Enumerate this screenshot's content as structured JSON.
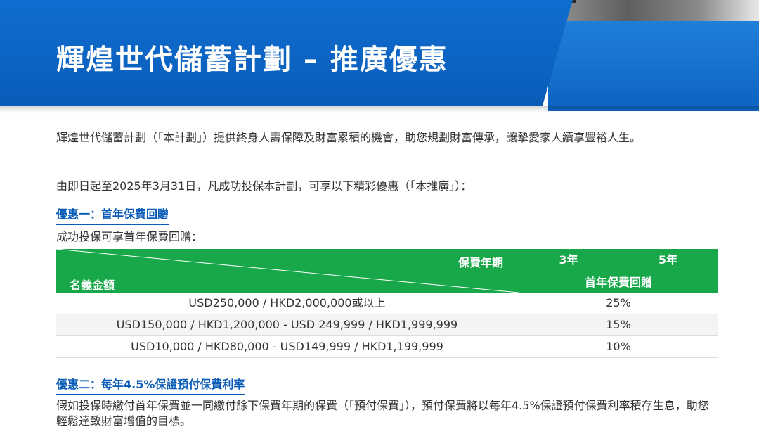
{
  "hero": {
    "title": "輝煌世代儲蓄計劃 – 推廣優惠",
    "colors": {
      "brand_blue": "#0a5cb8",
      "band_blue": "#1f7fd8"
    }
  },
  "intro": "輝煌世代儲蓄計劃（「本計劃」）提供終身人壽保障及財富累積的機會，助您規劃財富傳承，讓摯愛家人續享豐裕人生。",
  "period": "由即日起至2025年3月31日，凡成功投保本計劃，可享以下精彩優惠（「本推廣」）：",
  "offer1": {
    "heading": "優惠一：首年保費回贈",
    "description": "成功投保可享首年保費回贈："
  },
  "table": {
    "header_color": "#18a84a",
    "term_label": "保費年期",
    "amount_label": "名義金額",
    "term_3": "3年",
    "term_5": "5年",
    "rebate_label": "首年保費回贈",
    "rows": [
      {
        "amount": "USD250,000 / HKD2,000,000或以上",
        "rate": "25%"
      },
      {
        "amount": "USD150,000 / HKD1,200,000 - USD 249,999 / HKD1,999,999",
        "rate": "15%"
      },
      {
        "amount": "USD10,000 / HKD80,000 - USD149,999 / HKD1,199,999",
        "rate": "10%"
      }
    ]
  },
  "offer2": {
    "heading": "優惠二：每年4.5%保證預付保費利率",
    "description": "假如投保時繳付首年保費並一同繳付餘下保費年期的保費（「預付保費」），預付保費將以每年4.5%保證預付保費利率積存生息，助您輕鬆達致財富增值的目標。"
  }
}
